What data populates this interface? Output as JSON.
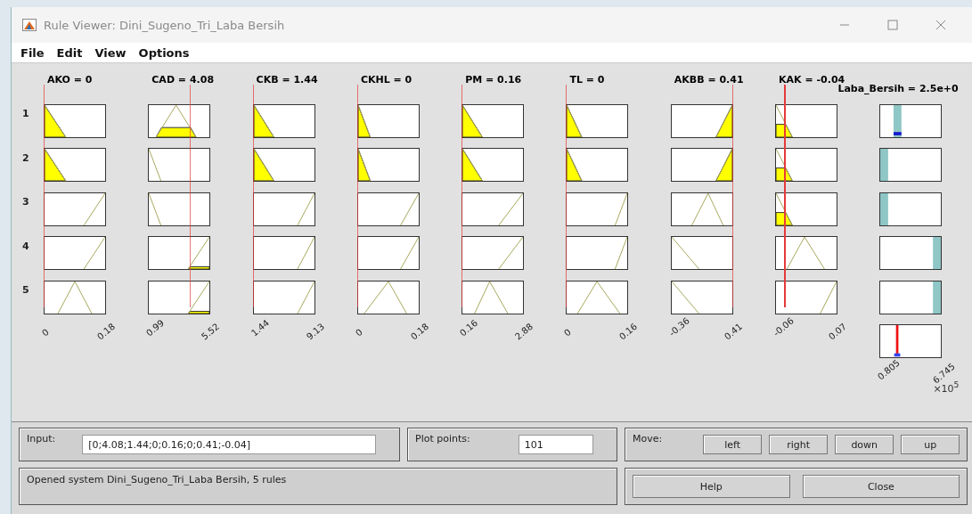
{
  "window": {
    "title": "Rule Viewer: Dini_Sugeno_Tri_Laba Bersih"
  },
  "menu": [
    "File",
    "Edit",
    "View",
    "Options"
  ],
  "rule_numbers": [
    "1",
    "2",
    "3",
    "4",
    "5"
  ],
  "inputs": [
    {
      "label": "AKO = 0",
      "min": "0",
      "max": "0.18"
    },
    {
      "label": "CAD = 4.08",
      "min": "0.99",
      "max": "5.52"
    },
    {
      "label": "CKB = 1.44",
      "min": "1.44",
      "max": "9.13"
    },
    {
      "label": "CKHL = 0",
      "min": "0",
      "max": "0.18"
    },
    {
      "label": "PM = 0.16",
      "min": "0.16",
      "max": "2.88"
    },
    {
      "label": "TL = 0",
      "min": "0",
      "max": "0.16"
    },
    {
      "label": "AKBB = 0.41",
      "min": "-0.36",
      "max": "0.41"
    },
    {
      "label": "KAK = -0.04",
      "min": "-0.06",
      "max": "0.07"
    }
  ],
  "output": {
    "label": "Laba_Bersih = 2.5e+0",
    "min": "0.805",
    "max": "6.745",
    "scale": "×10$^{5}$"
  },
  "controls": {
    "input_label": "Input:",
    "input_value": "[0;4.08;1.44;0;0.16;0;0.41;-0.04]",
    "plot_points_label": "Plot points:",
    "plot_points_value": "101",
    "move_label": "Move:",
    "move_buttons": [
      "left",
      "right",
      "down",
      "up"
    ]
  },
  "status": "Opened system Dini_Sugeno_Tri_Laba Bersih, 5 rules",
  "buttons": [
    "Help",
    "Close"
  ]
}
